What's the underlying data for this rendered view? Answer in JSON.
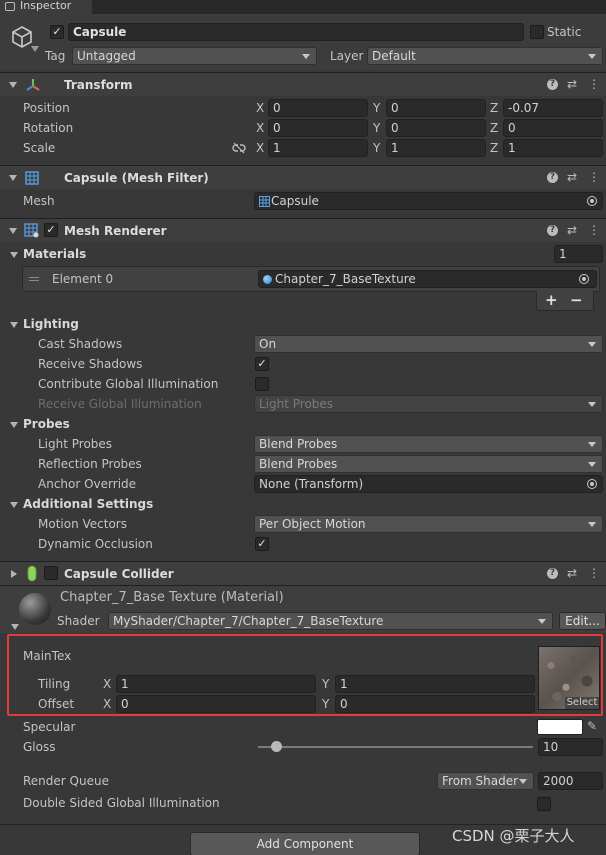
{
  "tab": {
    "label": "Inspector"
  },
  "object": {
    "name": "Capsule",
    "static_label": "Static",
    "tag_label": "Tag",
    "tag_value": "Untagged",
    "layer_label": "Layer",
    "layer_value": "Default"
  },
  "transform": {
    "title": "Transform",
    "rows": [
      {
        "label": "Position",
        "x": "0",
        "y": "0",
        "z": "-0.07"
      },
      {
        "label": "Rotation",
        "x": "0",
        "y": "0",
        "z": "0"
      },
      {
        "label": "Scale",
        "x": "1",
        "y": "1",
        "z": "1"
      }
    ],
    "axes": {
      "x": "X",
      "y": "Y",
      "z": "Z"
    }
  },
  "mesh_filter": {
    "title": "Capsule (Mesh Filter)",
    "mesh_label": "Mesh",
    "mesh_value": "Capsule"
  },
  "mesh_renderer": {
    "title": "Mesh Renderer",
    "materials_label": "Materials",
    "materials_count": "1",
    "element_label": "Element 0",
    "element_value": "Chapter_7_BaseTexture",
    "plus": "+",
    "minus": "−",
    "lighting_label": "Lighting",
    "cast_shadows_label": "Cast Shadows",
    "cast_shadows_value": "On",
    "receive_shadows_label": "Receive Shadows",
    "contribute_gi_label": "Contribute Global Illumination",
    "receive_gi_label": "Receive Global Illumination",
    "receive_gi_value": "Light Probes",
    "probes_label": "Probes",
    "light_probes_label": "Light Probes",
    "light_probes_value": "Blend Probes",
    "reflection_probes_label": "Reflection Probes",
    "reflection_probes_value": "Blend Probes",
    "anchor_override_label": "Anchor Override",
    "anchor_override_value": "None (Transform)",
    "additional_label": "Additional Settings",
    "motion_vectors_label": "Motion Vectors",
    "motion_vectors_value": "Per Object Motion",
    "dynamic_occlusion_label": "Dynamic Occlusion"
  },
  "capsule_collider": {
    "title": "Capsule Collider"
  },
  "material": {
    "title": "Chapter_7_Base Texture (Material)",
    "shader_label": "Shader",
    "shader_value": "MyShader/Chapter_7/Chapter_7_BaseTexture",
    "edit_label": "Edit...",
    "maintex_label": "MainTex",
    "tiling_label": "Tiling",
    "tiling_x": "1",
    "tiling_y": "1",
    "offset_label": "Offset",
    "offset_x": "0",
    "offset_y": "0",
    "select_label": "Select",
    "specular_label": "Specular",
    "gloss_label": "Gloss",
    "gloss_value": "10",
    "gloss_fraction": 0.05,
    "render_queue_label": "Render Queue",
    "render_queue_mode": "From Shader",
    "render_queue_value": "2000",
    "double_sided_label": "Double Sided Global Illumination"
  },
  "add_component": {
    "label": "Add Component"
  },
  "watermark": {
    "text": "CSDN @栗子大人"
  },
  "colors": {
    "highlight": "#e23b3b",
    "specular": "#ffffff"
  }
}
